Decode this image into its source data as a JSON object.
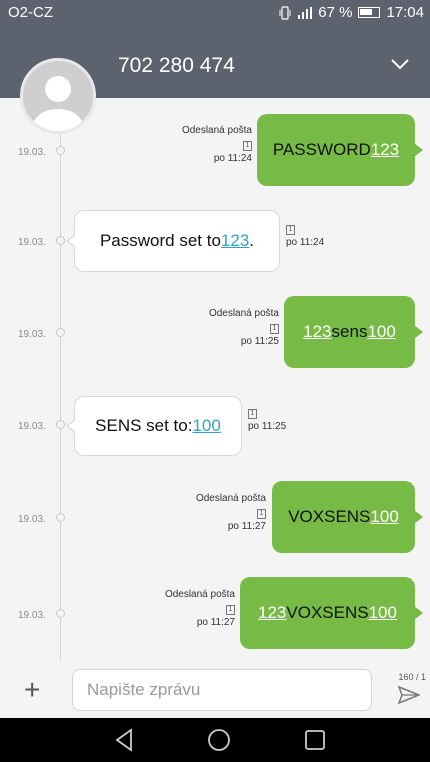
{
  "status_bar": {
    "carrier": "O2-CZ",
    "battery": "67 %",
    "time": "17:04"
  },
  "header": {
    "contact": "702 280 474"
  },
  "messages": [
    {
      "date": "19.03.",
      "direction": "out",
      "status": "Odeslaná pošta",
      "sim": "1",
      "time": "po 11:24",
      "parts": [
        {
          "t": "PASSWORD"
        },
        {
          "t": "123",
          "link": true
        }
      ]
    },
    {
      "date": "19.03.",
      "direction": "in",
      "sim": "1",
      "time": "po 11:24",
      "parts": [
        {
          "t": "Password set to "
        },
        {
          "t": "123",
          "link": true
        },
        {
          "t": "."
        }
      ]
    },
    {
      "date": "19.03.",
      "direction": "out",
      "status": "Odeslaná pošta",
      "sim": "1",
      "time": "po 11:25",
      "parts": [
        {
          "t": "123",
          "link": true
        },
        {
          "t": "sens"
        },
        {
          "t": "100",
          "link": true
        }
      ]
    },
    {
      "date": "19.03.",
      "direction": "in",
      "sim": "1",
      "time": "po 11:25",
      "parts": [
        {
          "t": "SENS set to: "
        },
        {
          "t": "100",
          "link": true
        }
      ]
    },
    {
      "date": "19.03.",
      "direction": "out",
      "status": "Odeslaná pošta",
      "sim": "1",
      "time": "po 11:27",
      "parts": [
        {
          "t": "VOXSENS"
        },
        {
          "t": "100",
          "link": true
        }
      ]
    },
    {
      "date": "19.03.",
      "direction": "out",
      "status": "Odeslaná pošta",
      "sim": "1",
      "time": "po 11:27",
      "parts": [
        {
          "t": "123",
          "link": true
        },
        {
          "t": "VOXSENS"
        },
        {
          "t": "100",
          "link": true
        }
      ]
    }
  ],
  "composer": {
    "placeholder": "Napište zprávu",
    "counter": "160 / 1"
  },
  "colors": {
    "outgoing": "#77bb46",
    "header": "#5d636e",
    "link_in": "#2fa6c6"
  }
}
